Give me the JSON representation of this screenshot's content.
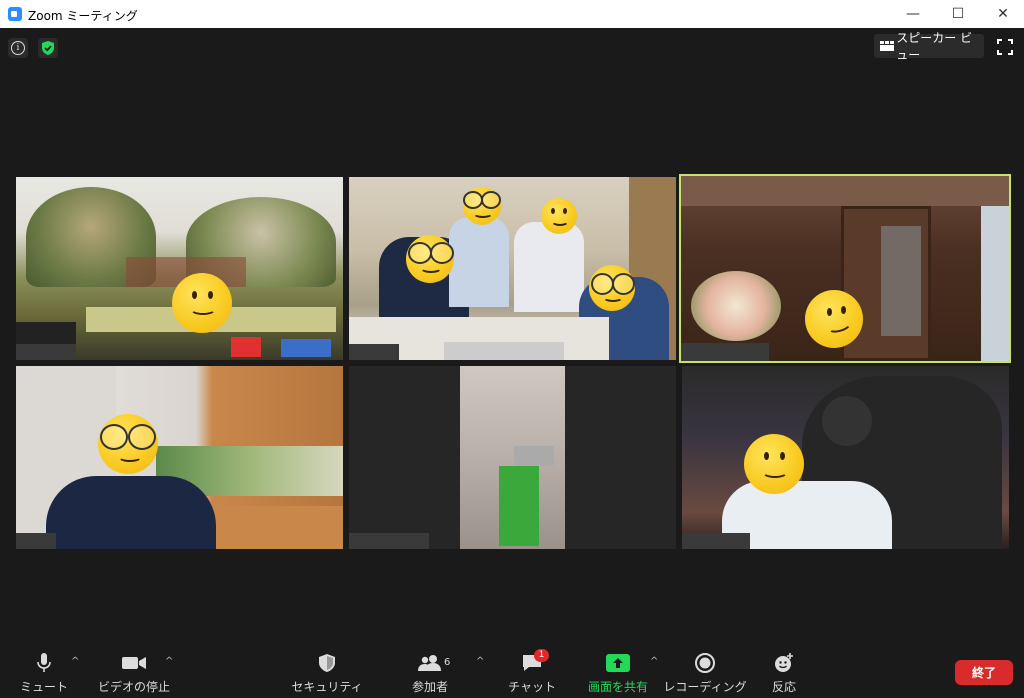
{
  "window": {
    "title": "Zoom ミーティング"
  },
  "top_controls": {
    "speaker_view_label": "スピーカー ビュー"
  },
  "toolbar": {
    "mute_label": "ミュート",
    "video_label": "ビデオの停止",
    "security_label": "セキュリティ",
    "participants_label": "参加者",
    "participants_count": "6",
    "chat_label": "チャット",
    "chat_badge": "1",
    "share_label": "画面を共有",
    "record_label": "レコーディング",
    "reactions_label": "反応",
    "end_label": "終了"
  },
  "colors": {
    "share_green": "#23d959",
    "active_speaker_border": "#c7e36b",
    "end_red": "#d92b2b"
  }
}
